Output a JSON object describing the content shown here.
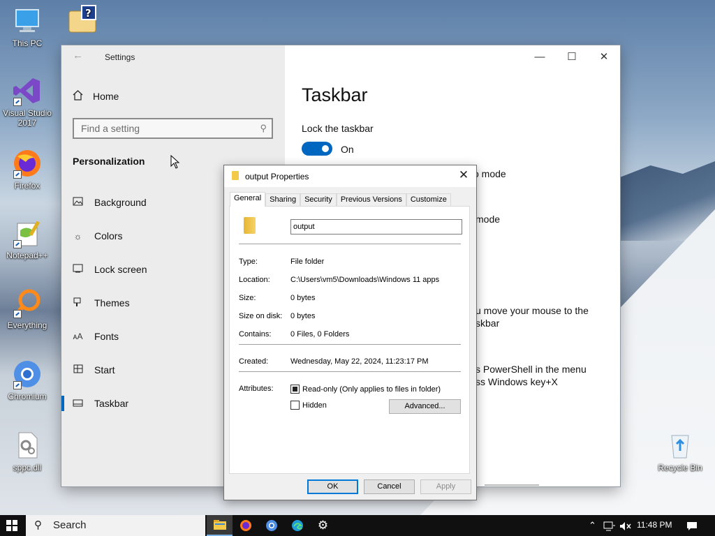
{
  "desktop": {
    "icons": [
      {
        "label": "This PC",
        "icon": "monitor-icon"
      },
      {
        "label": "",
        "icon": "winrar-icon"
      },
      {
        "label": "Visual Studio 2017",
        "icon": "visual-studio-icon"
      },
      {
        "label": "Firefox",
        "icon": "firefox-icon"
      },
      {
        "label": "Notepad++",
        "icon": "notepad-plus-plus-icon"
      },
      {
        "label": "Everything",
        "icon": "everything-search-icon"
      },
      {
        "label": "Chromium",
        "icon": "chromium-icon"
      },
      {
        "label": "sppc.dll",
        "icon": "dll-file-icon"
      },
      {
        "label": "Recycle Bin",
        "icon": "recycle-bin-icon"
      }
    ]
  },
  "settings": {
    "title": "Settings",
    "home": "Home",
    "search_placeholder": "Find a setting",
    "section": "Personalization",
    "nav": [
      {
        "label": "Background",
        "icon": "image-icon"
      },
      {
        "label": "Colors",
        "icon": "palette-icon"
      },
      {
        "label": "Lock screen",
        "icon": "lock-screen-icon"
      },
      {
        "label": "Themes",
        "icon": "brush-icon"
      },
      {
        "label": "Fonts",
        "icon": "font-icon"
      },
      {
        "label": "Start",
        "icon": "start-grid-icon"
      },
      {
        "label": "Taskbar",
        "icon": "taskbar-icon"
      }
    ],
    "page_title": "Taskbar",
    "lock_label": "Lock the taskbar",
    "lock_state": "On",
    "fragments": [
      "o mode",
      "mode",
      "u move your mouse to the",
      "skbar",
      "s PowerShell in the menu",
      "ss Windows key+X"
    ],
    "accent_color": "#0067c0"
  },
  "props": {
    "title": "output Properties",
    "tabs": [
      "General",
      "Sharing",
      "Security",
      "Previous Versions",
      "Customize"
    ],
    "name": "output",
    "rows": [
      {
        "k": "Type:",
        "v": "File folder"
      },
      {
        "k": "Location:",
        "v": "C:\\Users\\vm5\\Downloads\\Windows 11 apps"
      },
      {
        "k": "Size:",
        "v": "0 bytes"
      },
      {
        "k": "Size on disk:",
        "v": "0 bytes"
      },
      {
        "k": "Contains:",
        "v": "0 Files, 0 Folders"
      }
    ],
    "created_label": "Created:",
    "created_value": "Wednesday, May 22, 2024, 11:23:17 PM",
    "attributes_label": "Attributes:",
    "readonly_label": "Read-only (Only applies to files in folder)",
    "hidden_label": "Hidden",
    "advanced_label": "Advanced...",
    "ok_label": "OK",
    "cancel_label": "Cancel",
    "apply_label": "Apply"
  },
  "taskbar": {
    "search_label": "Search",
    "clock": "11:48 PM",
    "apps": [
      "file-explorer-icon",
      "firefox-icon",
      "chromium-icon",
      "edge-icon",
      "settings-gear-icon"
    ]
  }
}
